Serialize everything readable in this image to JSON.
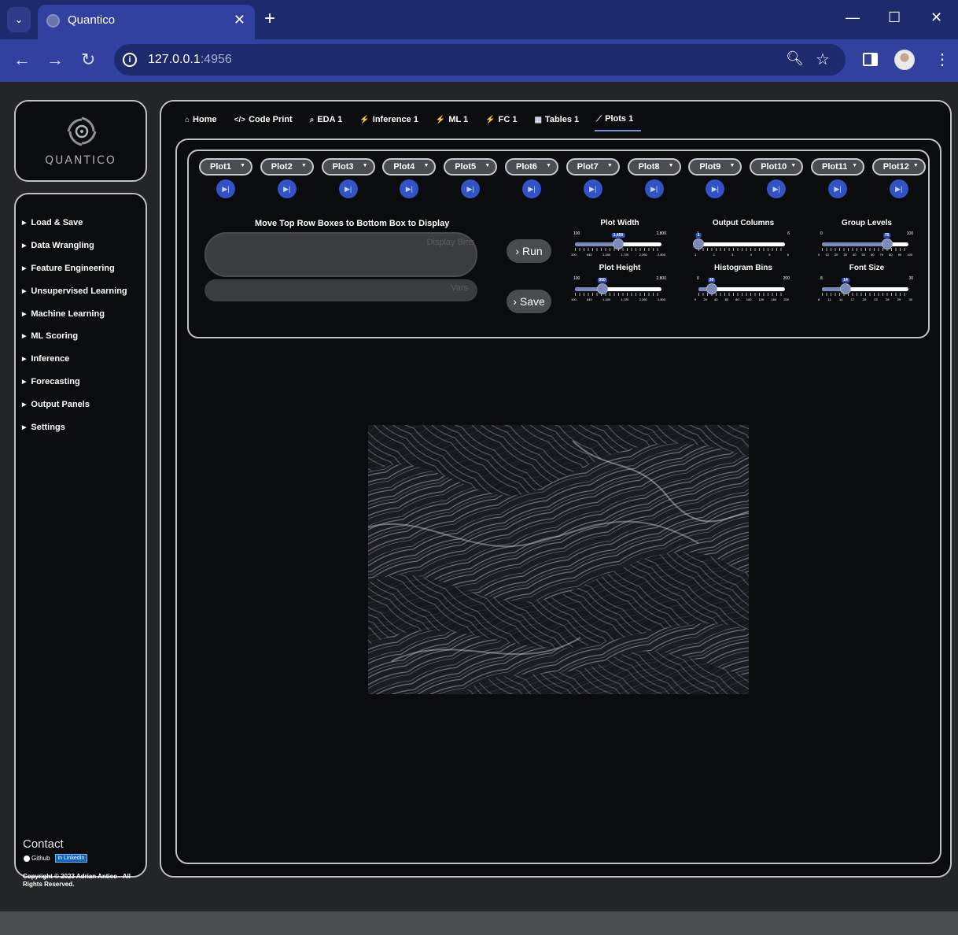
{
  "browser": {
    "tab_title": "Quantico",
    "url_host": "127.0.0.1",
    "url_port": ":4956"
  },
  "logo": {
    "wordmark": "QUANTICO"
  },
  "sidebar": {
    "items": [
      {
        "label": "Load & Save"
      },
      {
        "label": "Data Wrangling"
      },
      {
        "label": "Feature Engineering"
      },
      {
        "label": "Unsupervised Learning"
      },
      {
        "label": "Machine Learning"
      },
      {
        "label": "ML Scoring"
      },
      {
        "label": "Inference"
      },
      {
        "label": "Forecasting"
      },
      {
        "label": "Output Panels"
      },
      {
        "label": "Settings"
      }
    ],
    "contact_heading": "Contact",
    "github_label": "Github",
    "linkedin_label": "LinkedIn",
    "copyright": "Copyright © 2023 Adrian Antico - All Rights Reserved."
  },
  "tabs": [
    {
      "label": "Home",
      "icon": "home-icon",
      "glyph": "⌂"
    },
    {
      "label": "Code Print",
      "icon": "code-icon",
      "glyph": "</>"
    },
    {
      "label": "EDA 1",
      "icon": "search-icon",
      "glyph": "⌕"
    },
    {
      "label": "Inference 1",
      "icon": "wand-icon",
      "glyph": "⚡"
    },
    {
      "label": "ML 1",
      "icon": "wand-icon",
      "glyph": "⚡"
    },
    {
      "label": "FC 1",
      "icon": "wand-icon",
      "glyph": "⚡"
    },
    {
      "label": "Tables 1",
      "icon": "table-icon",
      "glyph": "▦"
    },
    {
      "label": "Plots 1",
      "icon": "chart-line-icon",
      "glyph": "⟋",
      "active": true
    }
  ],
  "plots": [
    "Plot1",
    "Plot2",
    "Plot3",
    "Plot4",
    "Plot5",
    "Plot6",
    "Plot7",
    "Plot8",
    "Plot9",
    "Plot10",
    "Plot11",
    "Plot12"
  ],
  "dropzone": {
    "label": "Move Top Row Boxes to Bottom Box to Display",
    "placeholder_top": "Display Bins",
    "placeholder_bottom": "Vars"
  },
  "buttons": {
    "run": "Run",
    "save": "Save"
  },
  "sliders": [
    {
      "id": "plot-width",
      "label": "Plot Width",
      "min": "100",
      "max": "2,800",
      "value": "1,450",
      "fraction": 0.5,
      "ticks": [
        "100",
        "640",
        "1,180",
        "1,720",
        "2,260",
        "2,800"
      ]
    },
    {
      "id": "output-columns",
      "label": "Output Columns",
      "min": "1",
      "max": "6",
      "value": "1",
      "fraction": 0.0,
      "ticks": [
        "1",
        "2",
        "3",
        "4",
        "5",
        "6"
      ]
    },
    {
      "id": "group-levels",
      "label": "Group Levels",
      "min": "0",
      "max": "100",
      "value": "75",
      "fraction": 0.75,
      "ticks": [
        "0",
        "10",
        "20",
        "30",
        "40",
        "50",
        "60",
        "70",
        "80",
        "90",
        "100"
      ]
    },
    {
      "id": "plot-height",
      "label": "Plot Height",
      "min": "100",
      "max": "2,800",
      "value": "950",
      "fraction": 0.315,
      "ticks": [
        "100",
        "640",
        "1,180",
        "1,720",
        "2,260",
        "2,800"
      ]
    },
    {
      "id": "histogram-bins",
      "label": "Histogram Bins",
      "min": "0",
      "max": "200",
      "value": "30",
      "fraction": 0.15,
      "ticks": [
        "0",
        "20",
        "40",
        "60",
        "80",
        "100",
        "120",
        "160",
        "200"
      ]
    },
    {
      "id": "font-size",
      "label": "Font Size",
      "min": "8",
      "max": "30",
      "value": "14",
      "fraction": 0.273,
      "ticks": [
        "8",
        "11",
        "14",
        "17",
        "20",
        "23",
        "26",
        "29",
        "30"
      ]
    }
  ]
}
